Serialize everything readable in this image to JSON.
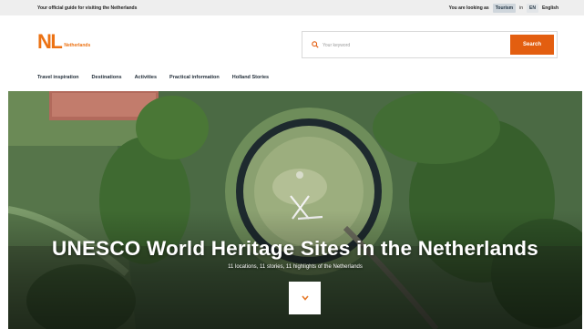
{
  "topbar": {
    "tagline": "Your official guide for visiting the Netherlands",
    "looking_as_label": "You are looking as",
    "audience": "Tourism",
    "in_label": "in",
    "lang_code": "EN",
    "lang_name": "English"
  },
  "header": {
    "logo_mark": "NL",
    "logo_text": "Netherlands"
  },
  "search": {
    "placeholder": "Your keyword",
    "button_label": "Search"
  },
  "nav": {
    "items": [
      "Travel inspiration",
      "Destinations",
      "Activities",
      "Practical information",
      "Holland Stories"
    ]
  },
  "hero": {
    "title": "UNESCO World Heritage Sites in the Netherlands",
    "subtitle": "11 locations, 11 stories, 11 highlights of the Netherlands",
    "cta_icon": "chevron-down-icon"
  },
  "colors": {
    "accent": "#e35e10",
    "logo": "#ec7213"
  }
}
